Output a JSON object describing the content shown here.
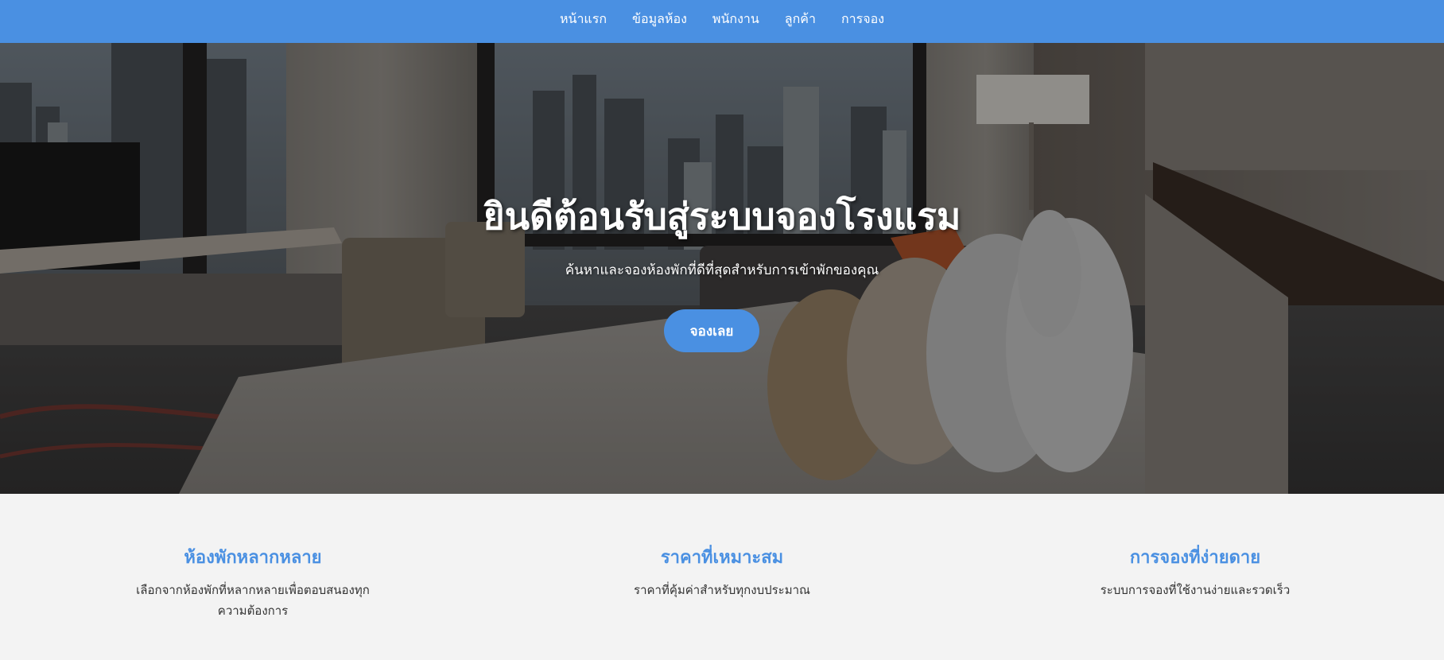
{
  "nav": {
    "items": [
      {
        "label": "หน้าแรก"
      },
      {
        "label": "ข้อมูลห้อง"
      },
      {
        "label": "พนักงาน"
      },
      {
        "label": "ลูกค้า"
      },
      {
        "label": "การจอง"
      }
    ]
  },
  "hero": {
    "title": "ยินดีต้อนรับสู่ระบบจองโรงแรม",
    "subtitle": "ค้นหาและจองห้องพักที่ดีที่สุดสำหรับการเข้าพักของคุณ",
    "button_label": "จองเลย"
  },
  "features": [
    {
      "title": "ห้องพักหลากหลาย",
      "description": "เลือกจากห้องพักที่หลากหลายเพื่อตอบสนองทุกความต้องการ"
    },
    {
      "title": "ราคาที่เหมาะสม",
      "description": "ราคาที่คุ้มค่าสำหรับทุกงบประมาณ"
    },
    {
      "title": "การจองที่ง่ายดาย",
      "description": "ระบบการจองที่ใช้งานง่ายและรวดเร็ว"
    }
  ],
  "colors": {
    "primary": "#4a90e2",
    "background": "#f3f3f3",
    "text": "#333333"
  }
}
